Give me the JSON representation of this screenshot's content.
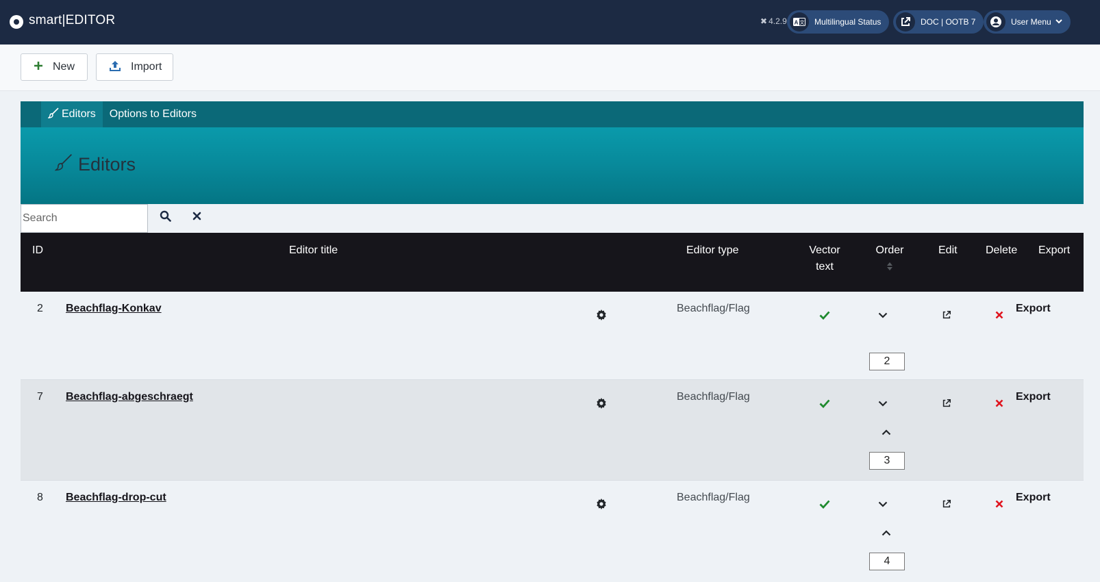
{
  "header": {
    "brand": "smart|EDITOR",
    "version": "4.2.9",
    "multilingual_label": "Multilingual Status",
    "doc_label": "DOC | OOTB 7",
    "user_menu_label": "User Menu"
  },
  "toolbar": {
    "new_label": "New",
    "import_label": "Import"
  },
  "tabs": [
    {
      "label": "Editors",
      "active": true
    },
    {
      "label": "Options to Editors",
      "active": false
    }
  ],
  "banner": {
    "title": "Editors"
  },
  "search": {
    "placeholder": "Search",
    "value": ""
  },
  "table": {
    "headers": {
      "id": "ID",
      "title": "Editor title",
      "type": "Editor type",
      "vector_line1": "Vector",
      "vector_line2": "text",
      "order": "Order",
      "edit": "Edit",
      "delete": "Delete",
      "export": "Export"
    },
    "rows": [
      {
        "id": "2",
        "title": "Beachflag-Konkav",
        "type": "Beachflag/Flag",
        "order": "2",
        "export": "Export"
      },
      {
        "id": "7",
        "title": "Beachflag-abgeschraegt",
        "type": "Beachflag/Flag",
        "order": "3",
        "export": "Export"
      },
      {
        "id": "8",
        "title": "Beachflag-drop-cut",
        "type": "Beachflag/Flag",
        "order": "4",
        "export": "Export"
      }
    ]
  },
  "colors": {
    "header_bg": "#1c2a43",
    "pill_bg": "#2c4b78",
    "tab_bar": "#0b6978",
    "banner": "#0a9aab",
    "table_head": "#16151b",
    "check_green": "#1e8a2e",
    "delete_red": "#e0141e"
  }
}
